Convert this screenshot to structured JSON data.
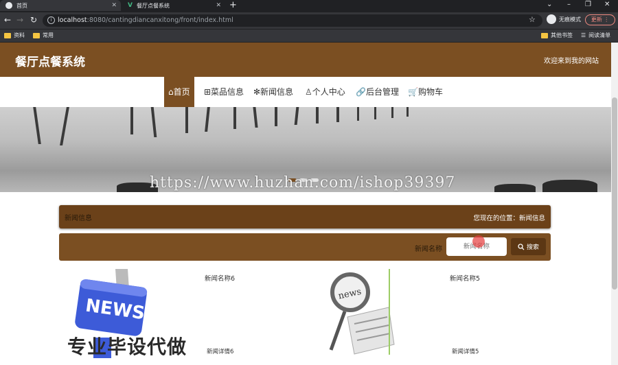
{
  "browser": {
    "tabs": [
      {
        "title": "首页"
      },
      {
        "title": "餐厅点餐系统"
      }
    ],
    "url_host": "localhost",
    "url_rest": ":8080/cantingdiancanxitong/front/index.html",
    "incognito_label": "无痕模式",
    "update_label": "更新",
    "bookmarks": [
      "资料",
      "常用"
    ],
    "bookmarks_right": [
      "其他书签",
      "阅读清单"
    ]
  },
  "header": {
    "title": "餐厅点餐系统",
    "welcome": "欢迎来到我的网站"
  },
  "nav": {
    "items": [
      "⌂首页",
      "⊞菜品信息",
      "✻新闻信息",
      "♙个人中心",
      "🔗后台管理",
      "🛒购物车"
    ]
  },
  "watermark": "https://www.huzhan.com/ishop39397",
  "crumb": {
    "title": "新闻信息",
    "location": "您现在的位置：新闻信息"
  },
  "search": {
    "label": "新闻名称",
    "placeholder": "新闻名称",
    "button": "搜索"
  },
  "news": [
    {
      "name": "新闻名称6",
      "detail": "新闻详情6"
    },
    {
      "name": "新闻名称5",
      "detail": "新闻详情5"
    }
  ],
  "overlay_text": "专业毕设代做",
  "colors": {
    "brand": "#7b4f22",
    "brand_dark": "#6b4119"
  }
}
